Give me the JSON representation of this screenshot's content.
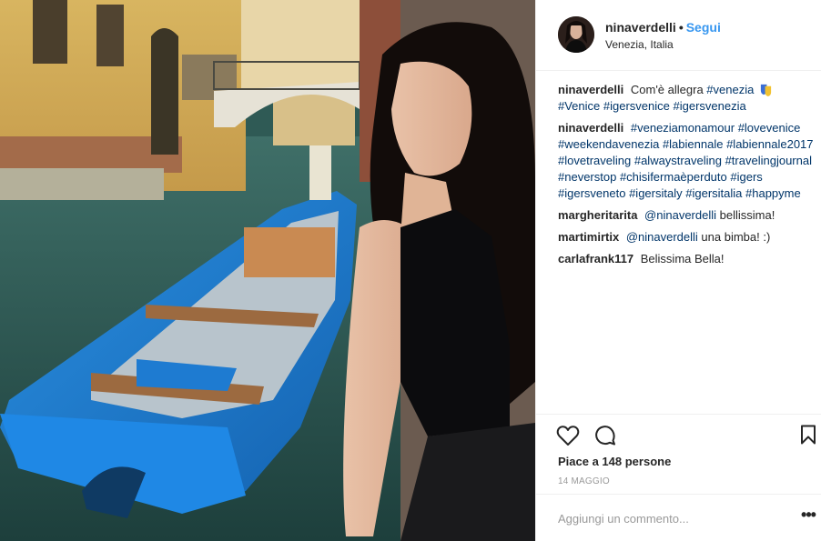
{
  "post": {
    "username": "ninaverdelli",
    "separator": "•",
    "follow_label": "Segui",
    "location": "Venezia, Italia"
  },
  "comments": [
    {
      "user": "ninaverdelli",
      "text": "Com'è allegra",
      "tags": [
        "#venezia"
      ],
      "emoji": "emoji-badge-icon",
      "tags2": [
        "#Venice",
        "#igersvenice",
        "#igersvenezia"
      ]
    },
    {
      "user": "ninaverdelli",
      "tags": [
        "#veneziamonamour",
        "#lovevenice",
        "#weekendavenezia",
        "#labiennale",
        "#labiennale2017",
        "#lovetraveling",
        "#alwaystraveling",
        "#travelingjournal",
        "#neverstop",
        "#chisifermaèperduto",
        "#igers",
        "#igersveneto",
        "#igersitaly",
        "#igersitalia",
        "#happyme"
      ]
    },
    {
      "user": "margheritarita",
      "mention": "@ninaverdelli",
      "text": "bellissima!"
    },
    {
      "user": "martimirtix",
      "mention": "@ninaverdelli",
      "text": "una bimba! :)"
    },
    {
      "user": "carlafrank117",
      "text": "Belissima Bella!"
    }
  ],
  "actions": {
    "like_icon": "heart-icon",
    "comment_icon": "comment-icon",
    "save_icon": "bookmark-icon",
    "likes_text": "Piace a 148 persone",
    "date": "14 MAGGIO",
    "comment_placeholder": "Aggiungi un commento...",
    "more_icon": "more-options-icon",
    "more_label": "•••"
  },
  "colors": {
    "link": "#003569",
    "follow": "#3897f0",
    "text": "#262626",
    "muted": "#999999",
    "divider": "#efefef"
  }
}
